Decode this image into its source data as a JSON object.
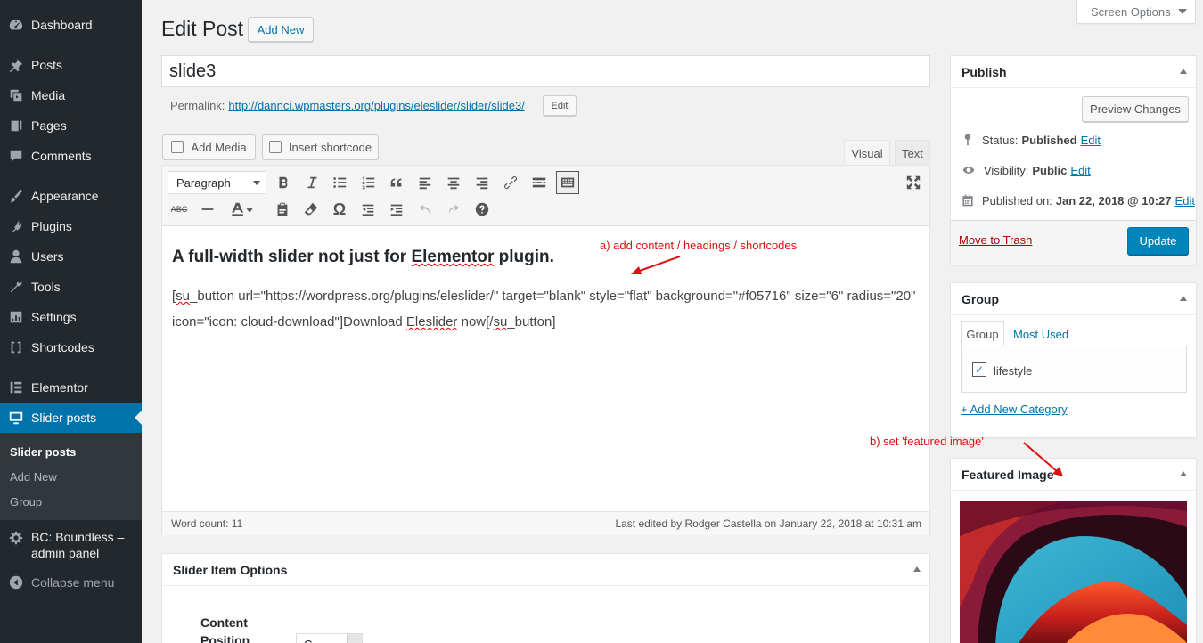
{
  "sidebar": {
    "items": [
      {
        "label": "Dashboard",
        "icon": "dashboard-icon"
      },
      {
        "label": "Posts",
        "icon": "pin-icon"
      },
      {
        "label": "Media",
        "icon": "media-icon"
      },
      {
        "label": "Pages",
        "icon": "page-icon"
      },
      {
        "label": "Comments",
        "icon": "comment-icon"
      },
      {
        "label": "Appearance",
        "icon": "brush-icon"
      },
      {
        "label": "Plugins",
        "icon": "plugin-icon"
      },
      {
        "label": "Users",
        "icon": "user-icon"
      },
      {
        "label": "Tools",
        "icon": "wrench-icon"
      },
      {
        "label": "Settings",
        "icon": "settings-icon"
      },
      {
        "label": "Shortcodes",
        "icon": "brackets-icon"
      },
      {
        "label": "Elementor",
        "icon": "elementor-icon"
      },
      {
        "label": "Slider posts",
        "icon": "monitor-icon"
      }
    ],
    "submenu": [
      "Slider posts",
      "Add New",
      "Group"
    ],
    "bc_line1": "BC: Boundless –",
    "bc_line2": "admin panel",
    "collapse": "Collapse menu"
  },
  "header": {
    "screen_options": "Screen Options",
    "title": "Edit Post",
    "add_new": "Add New"
  },
  "post": {
    "title": "slide3",
    "permalink_label": "Permalink:",
    "permalink_url": "http://dannci.wpmasters.org/plugins/eleslider/slider/slide3/",
    "permalink_edit": "Edit"
  },
  "editor": {
    "add_media": "Add Media",
    "insert_shortcode": "Insert shortcode",
    "tab_visual": "Visual",
    "tab_text": "Text",
    "format": "Paragraph",
    "heading_pre": "A full-width slider not just for ",
    "heading_sq": "Elementor",
    "heading_post": " plugin.",
    "para_1": "[",
    "para_sq1": "su",
    "para_2": "_button url=\"https://wordpress.org/plugins/eleslider/\" target=\"blank\" style=\"flat\" background=\"#f05716\" size=\"6\" radius=\"20\" icon=\"icon: cloud-download\"]Download ",
    "para_sq2": "Eleslider",
    "para_3": " now[/",
    "para_sq3": "su",
    "para_4": "_button]",
    "word_count": "Word count: 11",
    "last_edited": "Last edited by Rodger Castella on January 22, 2018 at 10:31 am"
  },
  "slider_options": {
    "title": "Slider Item Options",
    "content_label_1": "Content",
    "content_label_2": "Position",
    "select_value": "C"
  },
  "publish": {
    "title": "Publish",
    "preview": "Preview Changes",
    "status_label": "Status:",
    "status_value": "Published",
    "visibility_label": "Visibility:",
    "visibility_value": "Public",
    "published_label": "Published on:",
    "published_value": "Jan 22, 2018 @ 10:27",
    "edit": "Edit",
    "trash": "Move to Trash",
    "update": "Update"
  },
  "group": {
    "title": "Group",
    "tab_group": "Group",
    "tab_most_used": "Most Used",
    "category": "lifestyle",
    "add_new": "+ Add New Category"
  },
  "featured": {
    "title": "Featured Image"
  },
  "annotations": {
    "a": "a) add content / headings / shortcodes",
    "b": "b) set 'featured image'"
  },
  "colors": {
    "sidebar_bg": "#23282d",
    "accent": "#0073aa",
    "update_button": "#0085ba",
    "annotation": "#dd1111"
  }
}
